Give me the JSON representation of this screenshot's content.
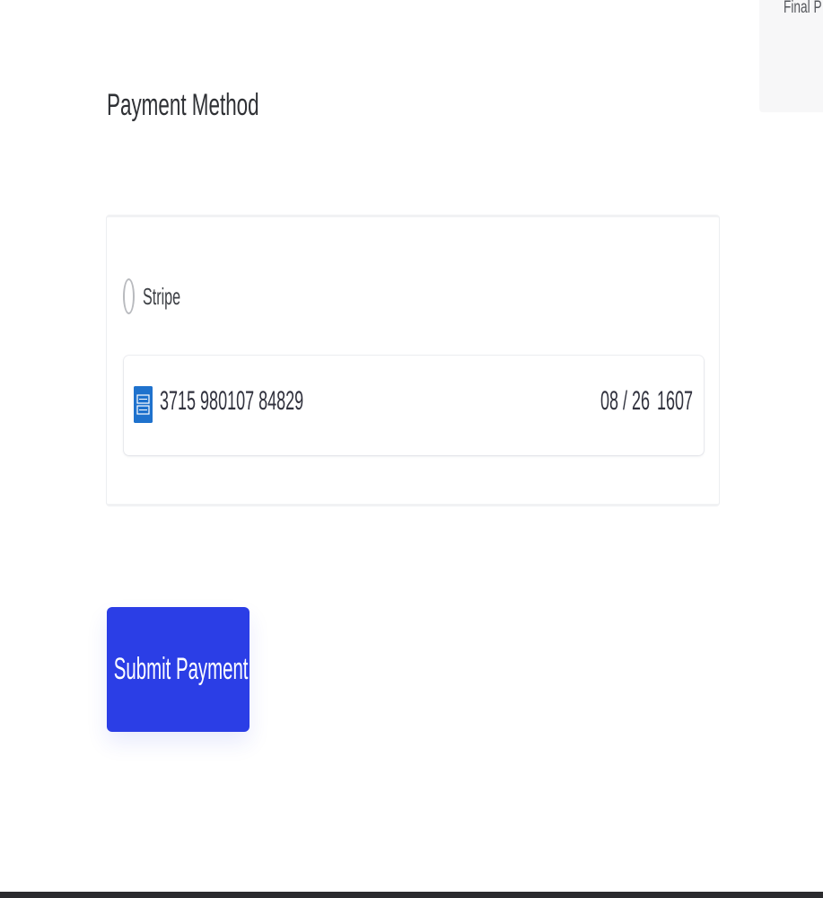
{
  "summary": {
    "label": "Final P"
  },
  "payment": {
    "title": "Payment Method",
    "option_label": "Stripe",
    "card": {
      "brand_icon": "amex-card-icon",
      "number": "3715 980107 84829",
      "expiry": "08 / 26",
      "cvc": "1607"
    }
  },
  "actions": {
    "submit_label": "Submit Payment"
  },
  "colors": {
    "accent": "#2b3ee6",
    "amex": "#1f72cd",
    "text": "#30313d"
  }
}
